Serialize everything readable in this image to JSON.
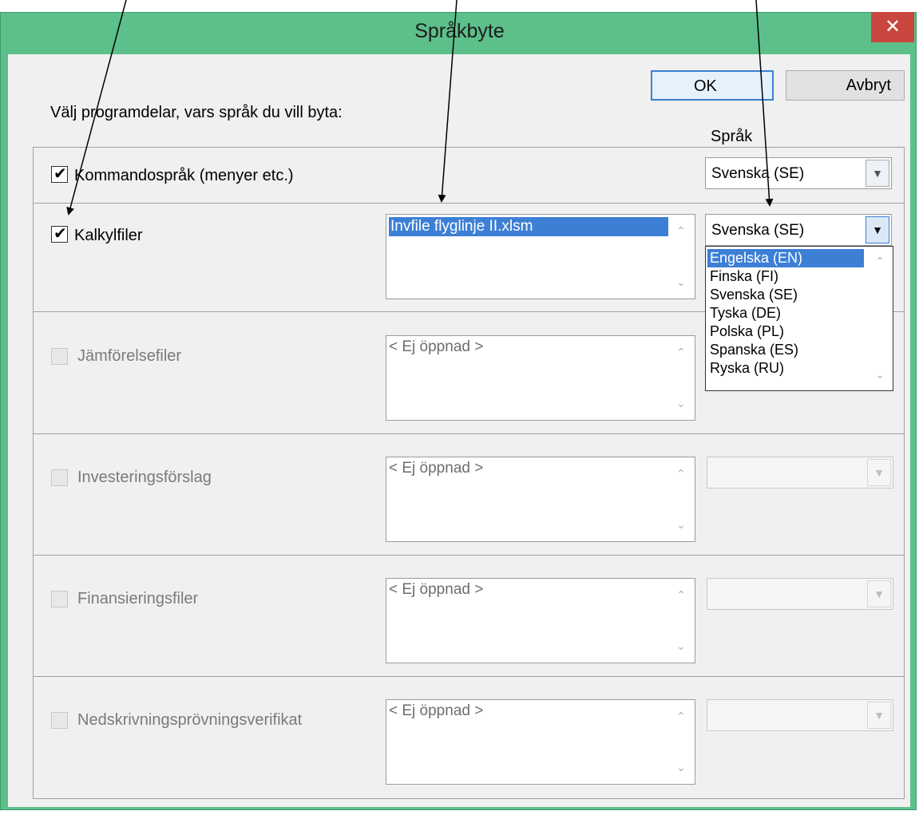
{
  "window": {
    "title": "Språkbyte",
    "close_glyph": "✕"
  },
  "buttons": {
    "ok": "OK",
    "cancel": "Avbryt"
  },
  "prompt": "Välj programdelar, vars språk du vill byta:",
  "lang_header": "Språk",
  "rows": [
    {
      "label": "Kommandospråk (menyer etc.)",
      "checked": true,
      "enabled": true,
      "language": "Svenska (SE)"
    },
    {
      "label": "Kalkylfiler",
      "checked": true,
      "enabled": true,
      "file": "Invfile flyglinje II.xlsm",
      "language": "Svenska (SE)"
    },
    {
      "label": "Jämförelsefiler",
      "checked": false,
      "enabled": false,
      "file": "< Ej öppnad >",
      "language": ""
    },
    {
      "label": "Investeringsförslag",
      "checked": false,
      "enabled": false,
      "file": "< Ej öppnad >",
      "language": ""
    },
    {
      "label": "Finansieringsfiler",
      "checked": false,
      "enabled": false,
      "file": "< Ej öppnad >",
      "language": ""
    },
    {
      "label": "Nedskrivningsprövningsverifikat",
      "checked": false,
      "enabled": false,
      "file": "< Ej öppnad >",
      "language": ""
    }
  ],
  "dropdown_options": [
    "Engelska (EN)",
    "Finska (FI)",
    "Svenska (SE)",
    "Tyska (DE)",
    "Polska (PL)",
    "Spanska (ES)",
    "Ryska (RU)"
  ],
  "dropdown_highlighted": "Engelska (EN)",
  "colors": {
    "title_bar": "#5dbf8a",
    "close": "#c9473f",
    "selection": "#3c7fd5"
  }
}
